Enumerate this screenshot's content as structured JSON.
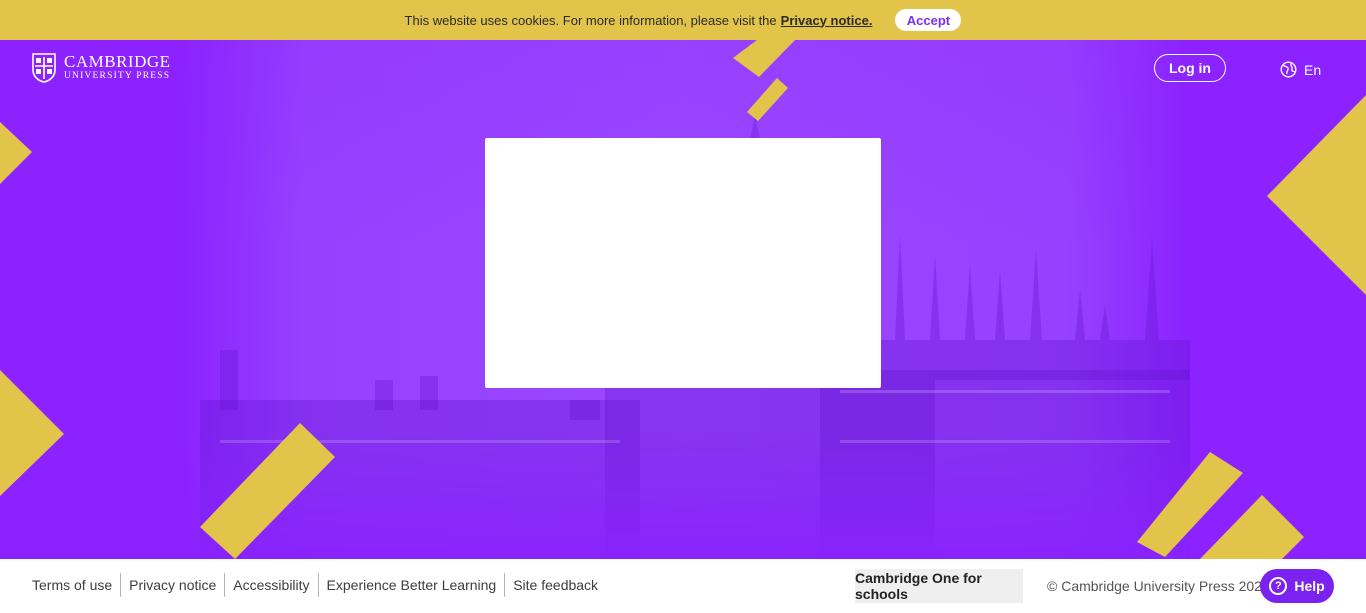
{
  "cookie": {
    "text": "This website uses cookies. For more information, please visit the",
    "link": "Privacy notice.",
    "accept": "Accept"
  },
  "header": {
    "brand_name": "CAMBRIDGE",
    "brand_sub": "UNIVERSITY PRESS",
    "login": "Log in",
    "language": "En"
  },
  "footer": {
    "links": [
      "Terms of use",
      "Privacy notice",
      "Accessibility",
      "Experience Better Learning",
      "Site feedback"
    ],
    "schools": "Cambridge One for schools",
    "copyright": "© Cambridge University Press 2021",
    "help": "Help"
  },
  "colors": {
    "accent_yellow": "#e3c44a",
    "hero_purple": "#8b22ff",
    "help_purple": "#7b22f0"
  },
  "icons": {
    "language": "globe-icon",
    "help": "question-circle-icon",
    "logo": "cambridge-shield-icon"
  }
}
